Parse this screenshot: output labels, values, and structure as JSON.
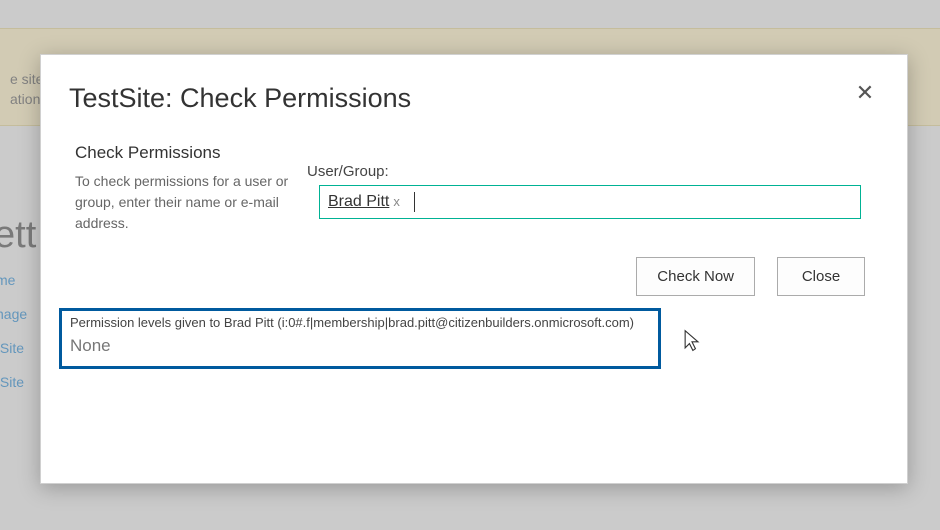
{
  "background": {
    "banner_line1": "e site",
    "banner_line2": "ation",
    "heading_partial": "ett",
    "links": [
      "me",
      "nage",
      "tSite",
      "tSite"
    ]
  },
  "dialog": {
    "title": "TestSite: Check Permissions",
    "section_heading": "Check Permissions",
    "section_desc": "To check permissions for a user or group, enter their name or e-mail address.",
    "field_label": "User/Group:",
    "picker": {
      "selected_name": "Brad Pitt",
      "remove_glyph": "x"
    },
    "buttons": {
      "check_now": "Check Now",
      "close": "Close"
    },
    "results": {
      "heading": "Permission levels given to Brad Pitt (i:0#.f|membership|brad.pitt@citizenbuilders.onmicrosoft.com)",
      "value": "None"
    }
  }
}
